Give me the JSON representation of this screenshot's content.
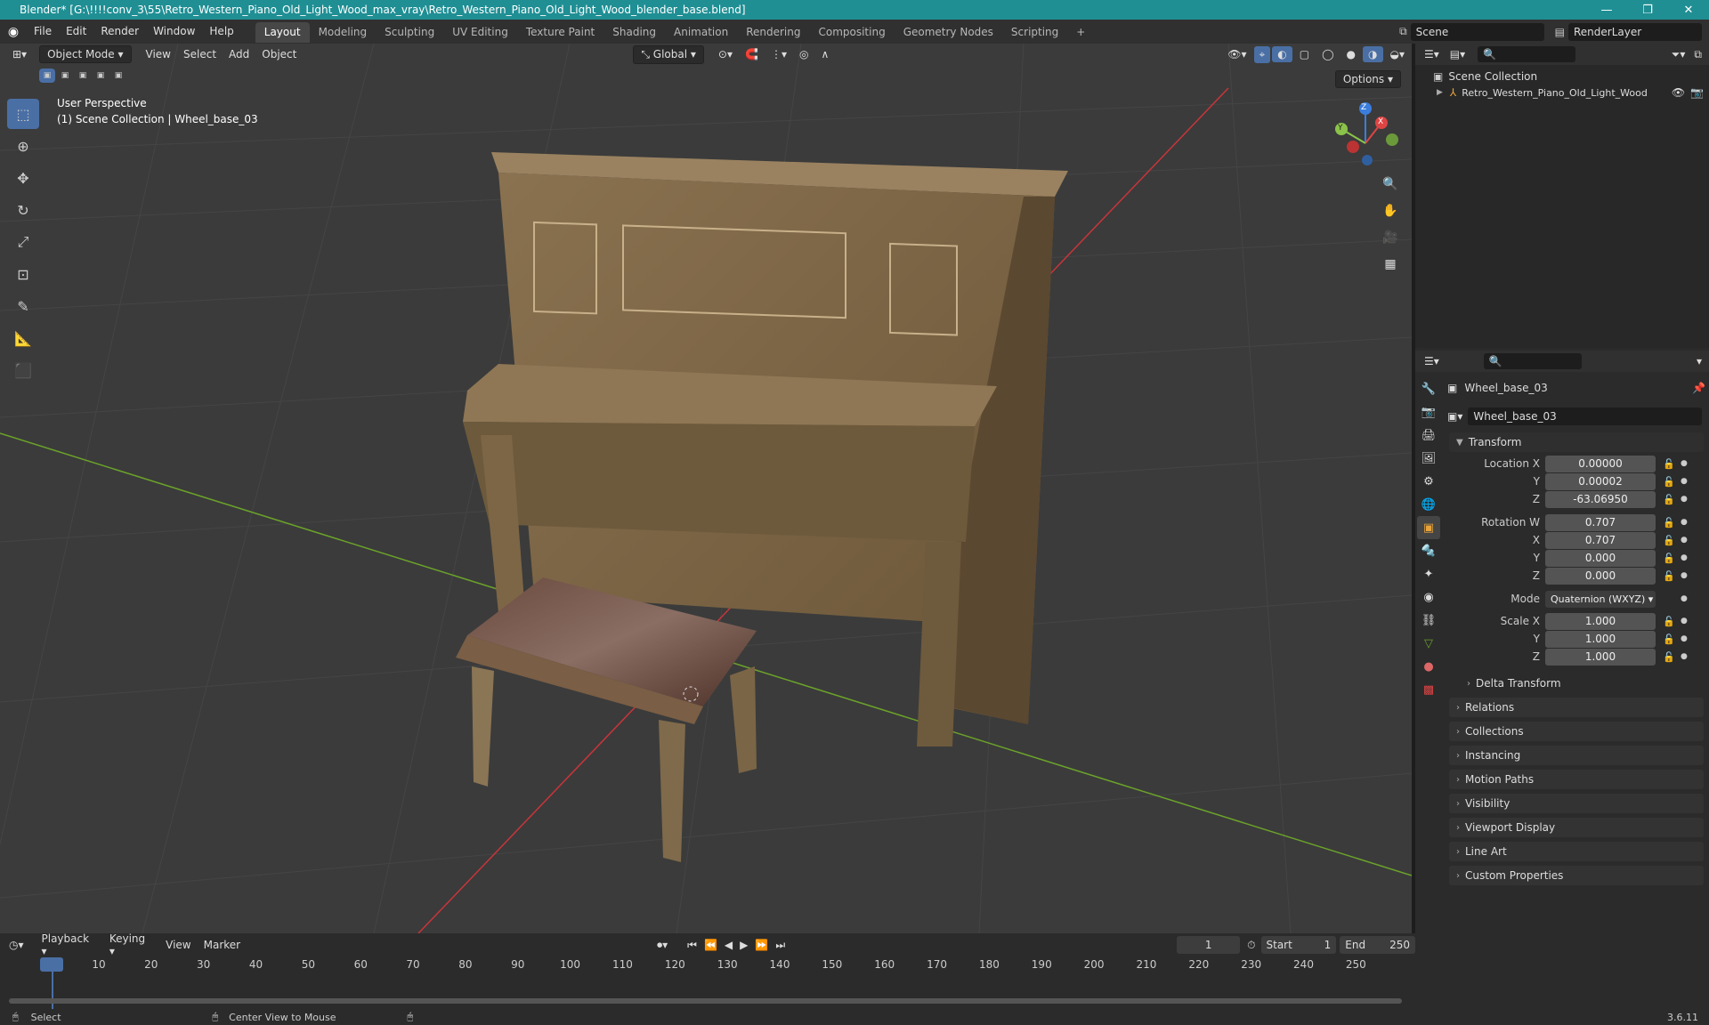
{
  "window": {
    "title": "Blender* [G:\\!!!!conv_3\\55\\Retro_Western_Piano_Old_Light_Wood_max_vray\\Retro_Western_Piano_Old_Light_Wood_blender_base.blend]"
  },
  "menu": [
    "File",
    "Edit",
    "Render",
    "Window",
    "Help"
  ],
  "workspaces": [
    "Layout",
    "Modeling",
    "Sculpting",
    "UV Editing",
    "Texture Paint",
    "Shading",
    "Animation",
    "Rendering",
    "Compositing",
    "Geometry Nodes",
    "Scripting"
  ],
  "active_workspace": "Layout",
  "scene": {
    "name": "Scene",
    "render_layer": "RenderLayer"
  },
  "viewport": {
    "mode": "Object Mode",
    "menus": [
      "View",
      "Select",
      "Add",
      "Object"
    ],
    "orientation": "Global",
    "options_label": "Options",
    "info_line1": "User Perspective",
    "info_line2": "(1) Scene Collection | Wheel_base_03",
    "gizmo": {
      "x": "X",
      "y": "Y",
      "z": "Z"
    }
  },
  "outliner": {
    "root": "Scene Collection",
    "items": [
      {
        "label": "Retro_Western_Piano_Old_Light_Wood"
      }
    ]
  },
  "properties": {
    "object_name": "Wheel_base_03",
    "data_name": "Wheel_base_03",
    "transform_label": "Transform",
    "location": {
      "label": "Location X",
      "x": "0.00000",
      "y": "0.00002",
      "z": "-63.06950"
    },
    "rotation": {
      "label": "Rotation W",
      "w": "0.707",
      "x": "0.707",
      "y": "0.000",
      "z": "0.000"
    },
    "mode": {
      "label": "Mode",
      "value": "Quaternion (WXYZ)"
    },
    "scale": {
      "label": "Scale X",
      "x": "1.000",
      "y": "1.000",
      "z": "1.000"
    },
    "axis_labels": {
      "y": "Y",
      "z": "Z",
      "x": "X"
    },
    "delta_transform": "Delta Transform",
    "panels": [
      "Relations",
      "Collections",
      "Instancing",
      "Motion Paths",
      "Visibility",
      "Viewport Display",
      "Line Art",
      "Custom Properties"
    ]
  },
  "timeline": {
    "menus": [
      "Playback",
      "Keying",
      "View",
      "Marker"
    ],
    "current_frame": "1",
    "start_label": "Start",
    "start": "1",
    "end_label": "End",
    "end": "250",
    "ticks": [
      "1",
      "10",
      "20",
      "30",
      "40",
      "50",
      "60",
      "70",
      "80",
      "90",
      "100",
      "110",
      "120",
      "130",
      "140",
      "150",
      "160",
      "170",
      "180",
      "190",
      "200",
      "210",
      "220",
      "230",
      "240",
      "250"
    ]
  },
  "status": {
    "left": "Select",
    "middle": "Center View to Mouse",
    "version": "3.6.11"
  },
  "colors": {
    "accent": "#4a6fa5",
    "titlebar": "#1f8f94",
    "xaxis": "#c8353b",
    "yaxis": "#6ba32a"
  }
}
